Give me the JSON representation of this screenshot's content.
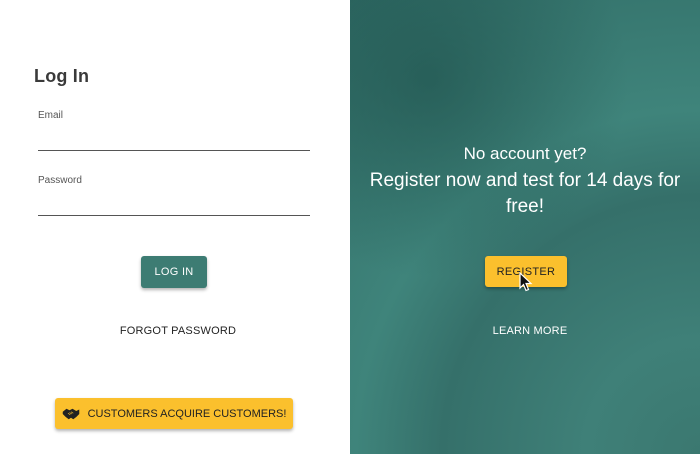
{
  "login": {
    "title": "Log In",
    "email_label": "Email",
    "email_value": "",
    "password_label": "Password",
    "password_value": "",
    "login_button": "LOG IN",
    "forgot_link": "FORGOT PASSWORD",
    "customers_button": "CUSTOMERS ACQUIRE CUSTOMERS!",
    "customers_icon": "handshake-icon"
  },
  "register": {
    "question": "No account yet?",
    "pitch": "Register now and test for 14 days for free!",
    "register_button": "REGISTER",
    "learn_more": "LEARN MORE"
  },
  "colors": {
    "primary": "#3d7c73",
    "accent": "#fbc02d",
    "panel": "#3a7b72"
  }
}
